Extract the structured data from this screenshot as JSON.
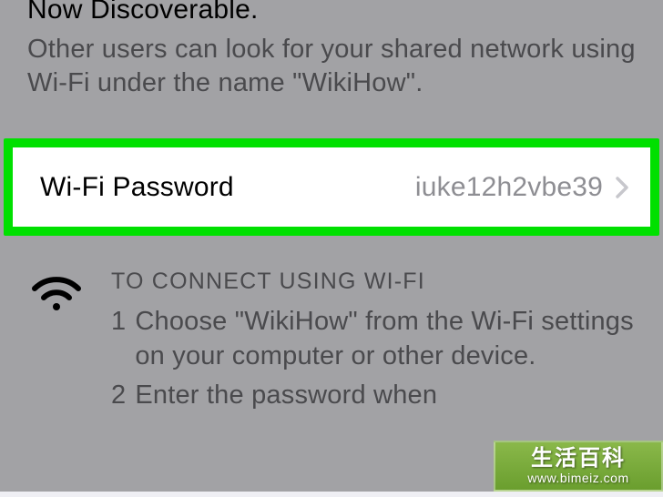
{
  "header": {
    "discoverable": "Now Discoverable.",
    "description": "Other users can look for your shared network using Wi-Fi under the name \"WikiHow\"."
  },
  "row": {
    "label": "Wi-Fi Password",
    "value": "iuke12h2vbe39"
  },
  "instructions": {
    "title": "TO CONNECT USING WI-FI",
    "steps": [
      {
        "num": "1",
        "text": "Choose \"WikiHow\" from the Wi-Fi settings on your computer or other device."
      },
      {
        "num": "2",
        "text": "Enter the password when"
      }
    ]
  },
  "watermark": {
    "top": "生活百科",
    "bottom": "www.bimeiz.com"
  }
}
